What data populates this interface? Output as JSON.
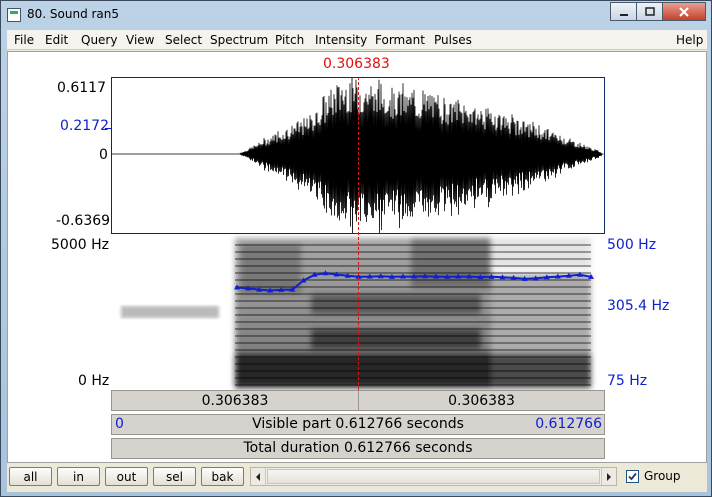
{
  "window": {
    "title": "80. Sound ran5"
  },
  "menu": [
    "File",
    "Edit",
    "Query",
    "View",
    "Select",
    "Spectrum",
    "Pitch",
    "Intensity",
    "Formant",
    "Pulses",
    "Help"
  ],
  "cursor": {
    "time_label": "0.306383"
  },
  "waveform": {
    "y_max": "0.6117",
    "y_cursor": "0.2172",
    "y_zero": "0",
    "y_min": "-0.6369"
  },
  "spectrogram": {
    "freq_top": "5000 Hz",
    "freq_bottom": "0 Hz"
  },
  "pitch": {
    "top": "500 Hz",
    "cursor": "305.4 Hz",
    "bottom": "75 Hz",
    "contour_hz": [
      265,
      262,
      258,
      255,
      257,
      258,
      290,
      312,
      318,
      313,
      308,
      304,
      305,
      306,
      304,
      305,
      305,
      306,
      305,
      304,
      305,
      305,
      303,
      304,
      302,
      300,
      296,
      298,
      302,
      305,
      308,
      312,
      304
    ]
  },
  "time_bar": {
    "left": "0.306383",
    "right": "0.306383"
  },
  "visible_bar": {
    "start": "0",
    "label": "Visible part 0.612766 seconds",
    "end": "0.612766"
  },
  "total_bar": {
    "label": "Total duration 0.612766 seconds"
  },
  "toolbar": {
    "all": "all",
    "in": "in",
    "out": "out",
    "sel": "sel",
    "bak": "bak",
    "group": "Group",
    "group_checked": true
  }
}
